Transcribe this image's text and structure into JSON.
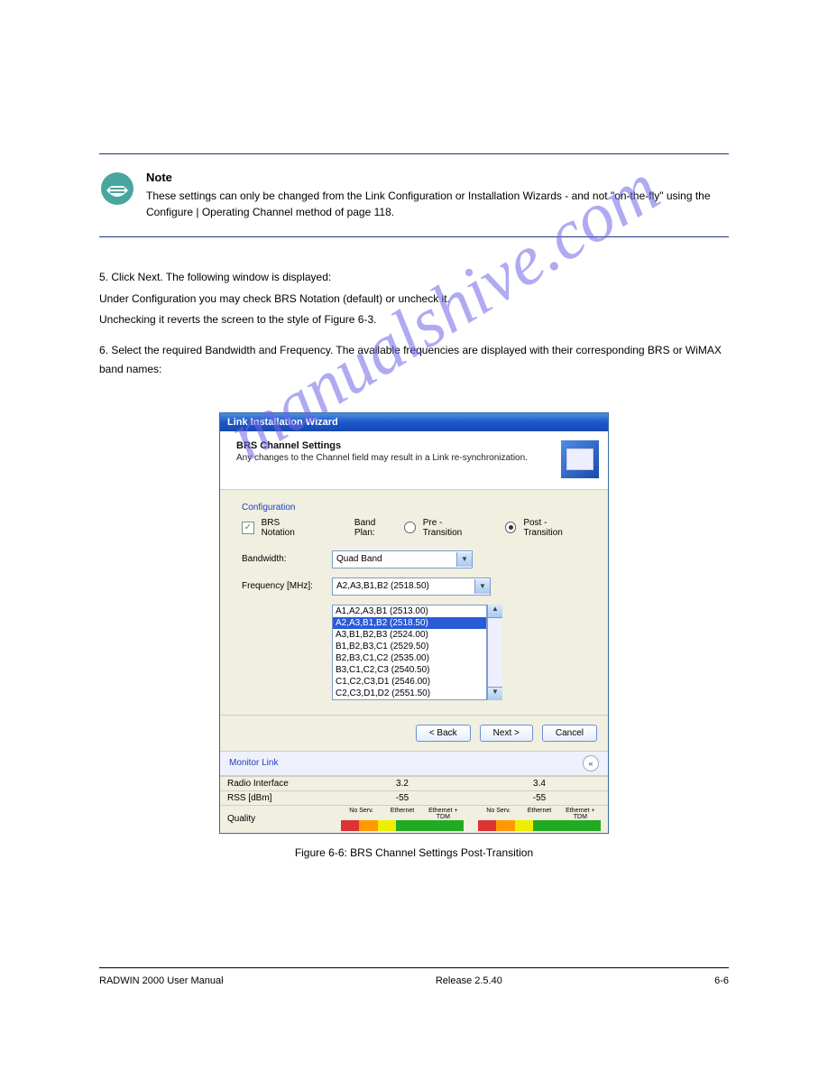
{
  "note": {
    "title": "Note",
    "text": "These settings can only be changed from the Link Configuration or Installation Wizards - and not \"on-the-fly\" using the Configure | Operating Channel method of page 118."
  },
  "body": {
    "p1": "5. Click Next. The following window is displayed:",
    "p2": "Under Configuration you may check BRS Notation (default) or uncheck it.",
    "p3": "Unchecking it reverts the screen to the style of Figure 6-3.",
    "p4": "6. Select the required Bandwidth and Frequency. The available frequencies are displayed with their corresponding BRS or WiMAX band names:"
  },
  "dialog": {
    "title": "Link Installation Wizard",
    "headerTitle": "BRS Channel Settings",
    "headerSub": "Any changes to the Channel field may result in a Link re-synchronization.",
    "sectionLabel": "Configuration",
    "brsNotationLabel": "BRS Notation",
    "bandPlanLabel": "Band Plan:",
    "preTransition": "Pre - Transition",
    "postTransition": "Post - Transition",
    "bandwidthLabel": "Bandwidth:",
    "bandwidthValue": "Quad Band",
    "frequencyLabel": "Frequency [MHz]:",
    "frequencyValue": "A2,A3,B1,B2 (2518.50)",
    "options": [
      "A1,A2,A3,B1 (2513.00)",
      "A2,A3,B1,B2 (2518.50)",
      "A3,B1,B2,B3 (2524.00)",
      "B1,B2,B3,C1 (2529.50)",
      "B2,B3,C1,C2 (2535.00)",
      "B3,C1,C2,C3 (2540.50)",
      "C1,C2,C3,D1 (2546.00)",
      "C2,C3,D1,D2 (2551.50)"
    ],
    "buttons": {
      "back": "< Back",
      "next": "Next >",
      "cancel": "Cancel"
    },
    "monitorLabel": "Monitor Link",
    "radioInterfaceLabel": "Radio Interface",
    "rssLabel": "RSS [dBm]",
    "qualityLabel": "Quality",
    "col1": "3.2",
    "col2": "3.4",
    "rss1": "-55",
    "rss2": "-55",
    "qlbl": {
      "a": "No Serv.",
      "b": "Ethernet",
      "c": "Ethernet + TDM"
    }
  },
  "figureCaption": "Figure 6-6: BRS Channel Settings Post-Transition",
  "footer": {
    "left": "RADWIN 2000 User Manual",
    "right": "Release 2.5.40",
    "page": "6-6"
  },
  "watermark": "manualshive.com"
}
